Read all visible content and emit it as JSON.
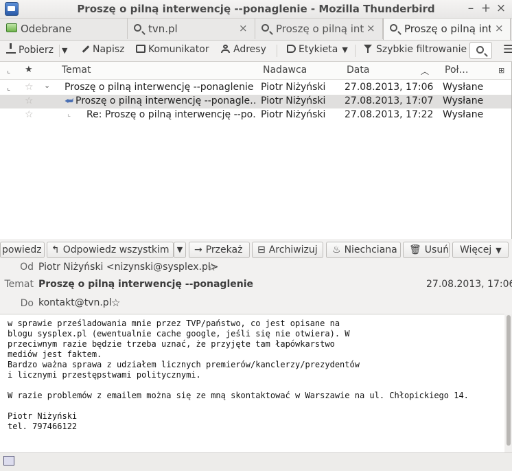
{
  "window": {
    "title": "Proszę o pilną interwencję --ponaglenie - Mozilla Thunderbird",
    "minimize": "–",
    "maximize": "+",
    "close": "×"
  },
  "tabs": [
    {
      "label": "Odebrane",
      "icon": "inbox-icon",
      "active": false
    },
    {
      "label": "tvn.pl",
      "icon": "search-icon",
      "active": false,
      "close": "×"
    },
    {
      "label": "Proszę o pilną inte",
      "icon": "search-icon",
      "active": false,
      "close": "×"
    },
    {
      "label": "Proszę o pilną inte",
      "icon": "search-icon",
      "active": true,
      "close": "×"
    }
  ],
  "toolbar": {
    "get": "Pobierz",
    "write": "Napisz",
    "chat": "Komunikator",
    "address": "Adresy",
    "tag": "Etykieta",
    "quickfilter": "Szybkie filtrowanie",
    "menu": "☰"
  },
  "thread_columns": {
    "subject": "Temat",
    "sender": "Nadawca",
    "date": "Data",
    "location": "Poł…"
  },
  "threads": [
    {
      "subject": "Proszę o pilną interwencję  --ponaglenie",
      "sender": "Piotr Niżyński",
      "date": "27.08.2013, 17:06",
      "location": "Wysłane"
    },
    {
      "subject": "Proszę o pilną interwencję  --ponagle…",
      "sender": "Piotr Niżyński",
      "date": "27.08.2013, 17:07",
      "location": "Wysłane"
    },
    {
      "subject": "Re: Proszę o pilną interwencję --po…",
      "sender": "Piotr Niżyński",
      "date": "27.08.2013, 17:22",
      "location": "Wysłane"
    }
  ],
  "message_toolbar": {
    "reply": "powiedz",
    "reply_all": "Odpowiedz wszystkim",
    "forward": "Przekaż",
    "archive": "Archiwizuj",
    "junk": "Niechciana",
    "delete": "Usuń",
    "more": "Więcej"
  },
  "headers": {
    "from_label": "Od",
    "from": "Piotr Niżyński <nizynski@sysplex.pl>",
    "subject_label": "Temat",
    "subject": "Proszę o pilną interwencję --ponaglenie",
    "date": "27.08.2013, 17:06",
    "to_label": "Do",
    "to": "kontakt@tvn.pl"
  },
  "body": "w sprawie prześladowania mnie przez TVP/państwo, co jest opisane na\nblogu sysplex.pl (ewentualnie cache google, jeśli się nie otwiera). W\nprzeciwnym razie będzie trzeba uznać, że przyjęte tam łapówkarstwo\nmediów jest faktem.\nBardzo ważna sprawa z udziałem licznych premierów/kanclerzy/prezydentów\ni licznymi przestępstwami politycznymi.\n\nW razie problemów z emailem można się ze mną skontaktować w Warszawie na ul. Chłopickiego 14.\n\nPiotr Niżyński\ntel. 797466122"
}
